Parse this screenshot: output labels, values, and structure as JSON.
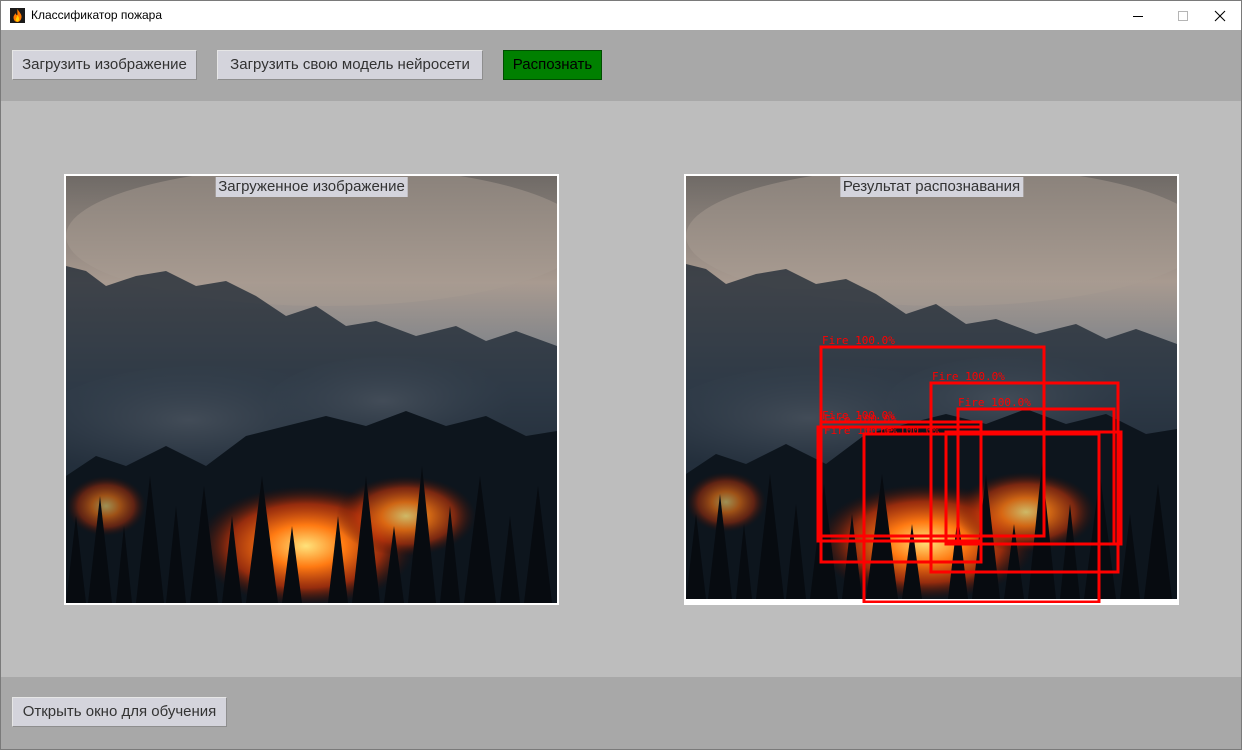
{
  "window": {
    "title": "Классификатор пожара",
    "icon": "fire-icon",
    "controls": [
      "minimize-icon",
      "maximize-icon",
      "close-icon"
    ]
  },
  "toolbar": {
    "load_image_label": "Загрузить изображение",
    "load_model_label": "Загрузить свою модель нейросети",
    "recognize_label": "Распознать",
    "recognize_color": "#008000"
  },
  "panels": {
    "input_caption": "Загруженное изображение",
    "result_caption": "Результат распознавания"
  },
  "detections": {
    "color": "#ff0000",
    "labels": [
      "Fire 100.0%",
      "Fire 100.0%",
      "Fire 100.0%",
      "Fire 100.0%",
      "Fire 100.0%",
      "Fire 100.0%",
      "Fire 100.0%"
    ]
  },
  "bottom": {
    "train_label": "Открыть окно для обучения"
  }
}
